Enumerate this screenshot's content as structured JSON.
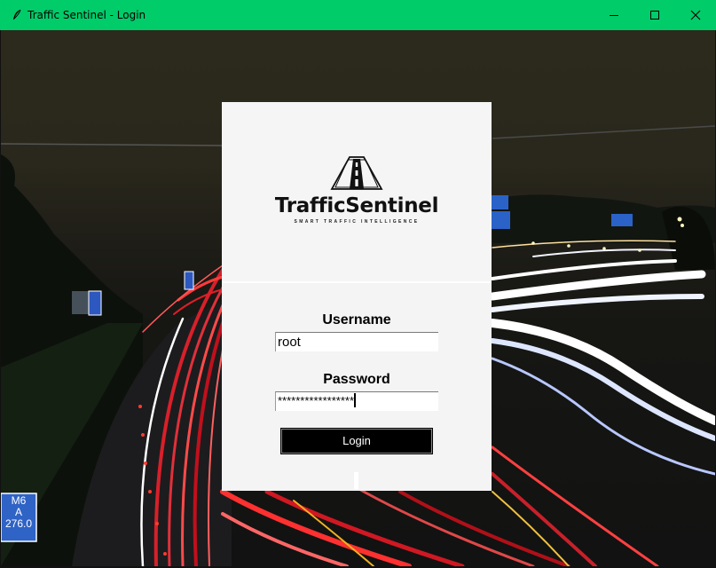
{
  "window": {
    "title": "Traffic Sentinel - Login",
    "icon": "feather-icon",
    "controls": [
      "minimize-icon",
      "maximize-icon",
      "close-icon"
    ],
    "accent_color": "#00cc6a"
  },
  "background": {
    "signs": [
      {
        "text_line1": "M6",
        "text_line2": "A",
        "text_line3": "276.0"
      }
    ]
  },
  "brand": {
    "name": "TrafficSentinel",
    "tagline": "SMART TRAFFIC INTELLIGENCE",
    "logo_icon": "road-icon"
  },
  "login": {
    "username_label": "Username",
    "username_value": "root",
    "password_label": "Password",
    "password_value": "*****************",
    "login_label": "Login"
  }
}
